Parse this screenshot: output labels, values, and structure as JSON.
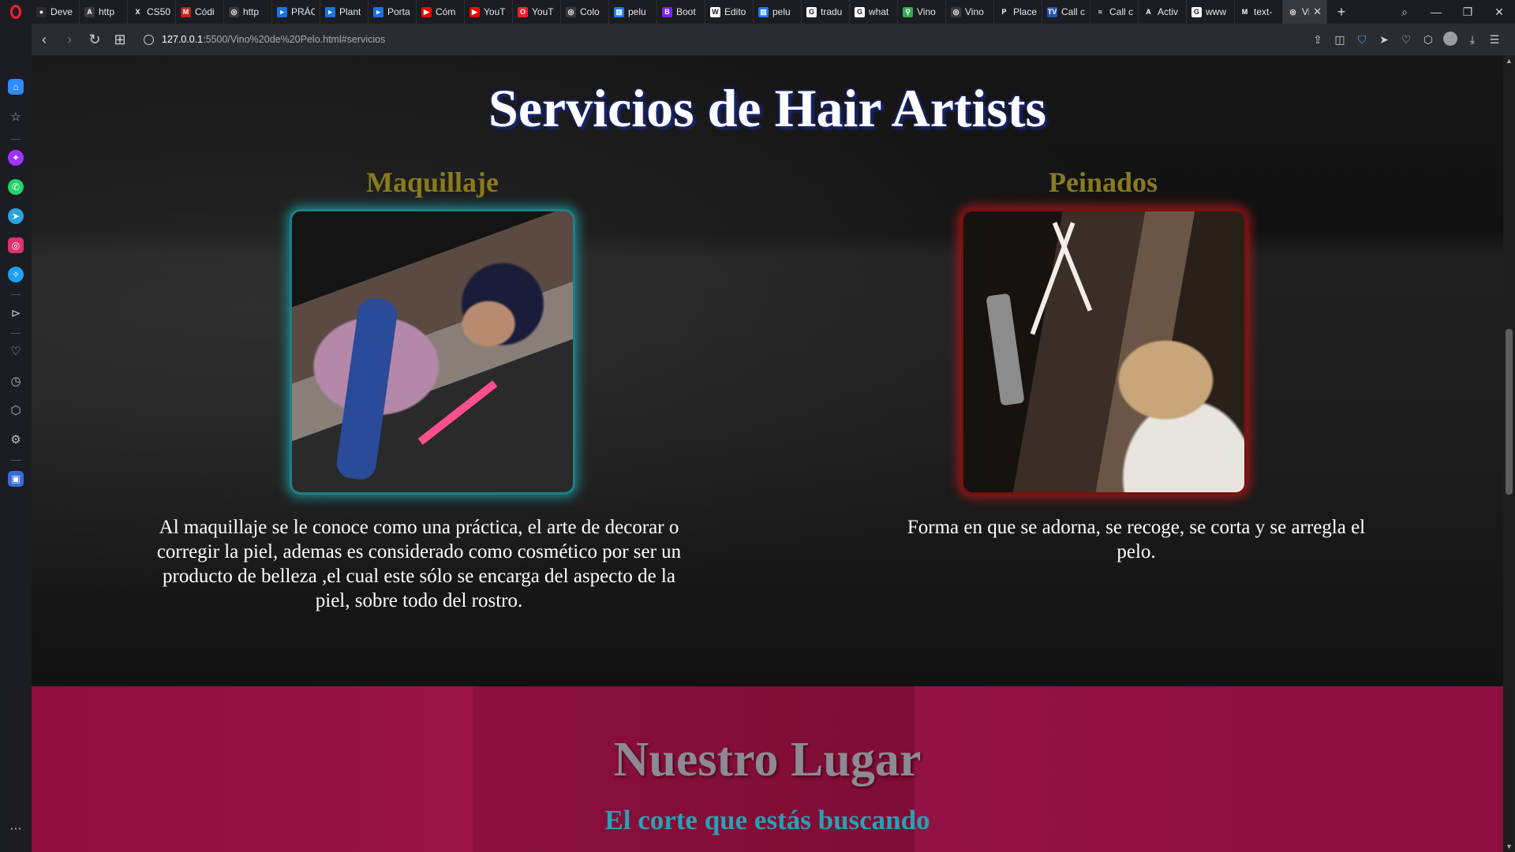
{
  "browser": {
    "tabs": [
      {
        "label": "Deve",
        "icon": "github-icon",
        "color": "#2b2b2b",
        "glyph": "●"
      },
      {
        "label": "http",
        "icon": "web-icon",
        "color": "#3a3a3a",
        "glyph": "A"
      },
      {
        "label": "CS50",
        "icon": "cs50-icon",
        "color": "#1b1d22",
        "glyph": "X"
      },
      {
        "label": "Códi",
        "icon": "gmail-icon",
        "color": "#c5221f",
        "glyph": "M"
      },
      {
        "label": "http",
        "icon": "globe-icon",
        "color": "#3a3a3a",
        "glyph": "◎"
      },
      {
        "label": "PRÁC",
        "icon": "docs-icon",
        "color": "#1a73e8",
        "glyph": "▸"
      },
      {
        "label": "Plant",
        "icon": "docs-icon",
        "color": "#1a73e8",
        "glyph": "▸"
      },
      {
        "label": "Porta",
        "icon": "docs-icon",
        "color": "#1a73e8",
        "glyph": "▸"
      },
      {
        "label": "Cóm",
        "icon": "youtube-icon",
        "color": "#ff0000",
        "glyph": "▶"
      },
      {
        "label": "YouT",
        "icon": "youtube-icon",
        "color": "#ff0000",
        "glyph": "▶"
      },
      {
        "label": "YouT",
        "icon": "opera-icon",
        "color": "#ff1b2d",
        "glyph": "O"
      },
      {
        "label": "Colo",
        "icon": "globe-icon",
        "color": "#3a3a3a",
        "glyph": "◎"
      },
      {
        "label": "pelu",
        "icon": "trello-icon",
        "color": "#1d7afc",
        "glyph": "▥"
      },
      {
        "label": "Boot",
        "icon": "bootstrap-icon",
        "color": "#7a23e6",
        "glyph": "B"
      },
      {
        "label": "Edito",
        "icon": "wix-icon",
        "color": "#ffffff",
        "glyph": "W"
      },
      {
        "label": "pelu",
        "icon": "trello-icon",
        "color": "#1d7afc",
        "glyph": "▥"
      },
      {
        "label": "tradu",
        "icon": "google-icon",
        "color": "#ffffff",
        "glyph": "G"
      },
      {
        "label": "what",
        "icon": "google-icon",
        "color": "#ffffff",
        "glyph": "G"
      },
      {
        "label": "Vino",
        "icon": "maps-icon",
        "color": "#34a853",
        "glyph": "⚲"
      },
      {
        "label": "Vino",
        "icon": "globe-icon",
        "color": "#3a3a3a",
        "glyph": "◎"
      },
      {
        "label": "Place",
        "icon": "placeit-icon",
        "color": "#1b1d22",
        "glyph": "P"
      },
      {
        "label": "Call c",
        "icon": "tv-icon",
        "color": "#2255aa",
        "glyph": "TV"
      },
      {
        "label": "Call c",
        "icon": "tv-icon",
        "color": "#1b1d22",
        "glyph": "≈"
      },
      {
        "label": "Activ",
        "icon": "arch-icon",
        "color": "#1b1d22",
        "glyph": "A"
      },
      {
        "label": "www",
        "icon": "google-icon",
        "color": "#ffffff",
        "glyph": "G"
      },
      {
        "label": "text-",
        "icon": "mdn-icon",
        "color": "#1b1d22",
        "glyph": "M"
      }
    ],
    "active_tab": {
      "label": "Vi",
      "icon": "globe-icon"
    },
    "url_host": "127.0.0.1",
    "url_path": ":5500/Vino%20de%20Pelo.html#servicios"
  },
  "page": {
    "services_title": "Servicios de Hair Artists",
    "services": [
      {
        "title": "Maquillaje",
        "description": "Al maquillaje se le conoce como una práctica, el arte de decorar o corregir la piel, ademas es considerado como cosmético por ser un producto de belleza ,el cual este sólo se encarga del aspecto de la piel, sobre todo del rostro."
      },
      {
        "title": "Peinados",
        "description": "Forma en que se adorna, se recoge, se corta y se arregla el pelo."
      }
    ],
    "lugar_title": "Nuestro Lugar",
    "lugar_subtitle": "El corte que estás buscando"
  },
  "colors": {
    "services_title_shadow": "#1a2a8c",
    "service_title": "#8a7a20",
    "makeup_glow": "#1f9aa5",
    "hair_glow": "#c01a1a",
    "lugar_bg": "#8e0f3d",
    "lugar_title": "#8c8a92",
    "lugar_subtitle": "#2aa0b4"
  }
}
